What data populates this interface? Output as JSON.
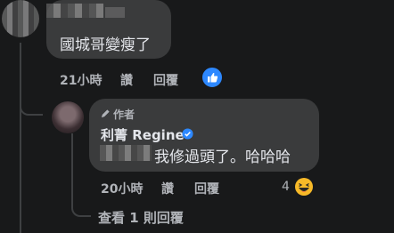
{
  "comment": {
    "text": "國城哥變瘦了",
    "time": "21小時",
    "like_label": "讚",
    "reply_label": "回覆",
    "reaction_icon": "like-icon",
    "reaction_color": "#2d88ff"
  },
  "reply": {
    "author_badge": "作者",
    "author_name": "利菁 Regine",
    "verified_color": "#2d88ff",
    "text": "我修過頭了。哈哈哈",
    "time": "20小時",
    "like_label": "讚",
    "reply_label": "回覆",
    "reaction_count": "4",
    "reaction_icon": "haha-icon"
  },
  "view_more": {
    "label": "查看 1 則回覆"
  },
  "colors": {
    "background": "#18191a",
    "bubble": "#3a3b3c",
    "text_primary": "#e4e6eb",
    "text_secondary": "#b0b3b8",
    "accent": "#2d88ff"
  }
}
